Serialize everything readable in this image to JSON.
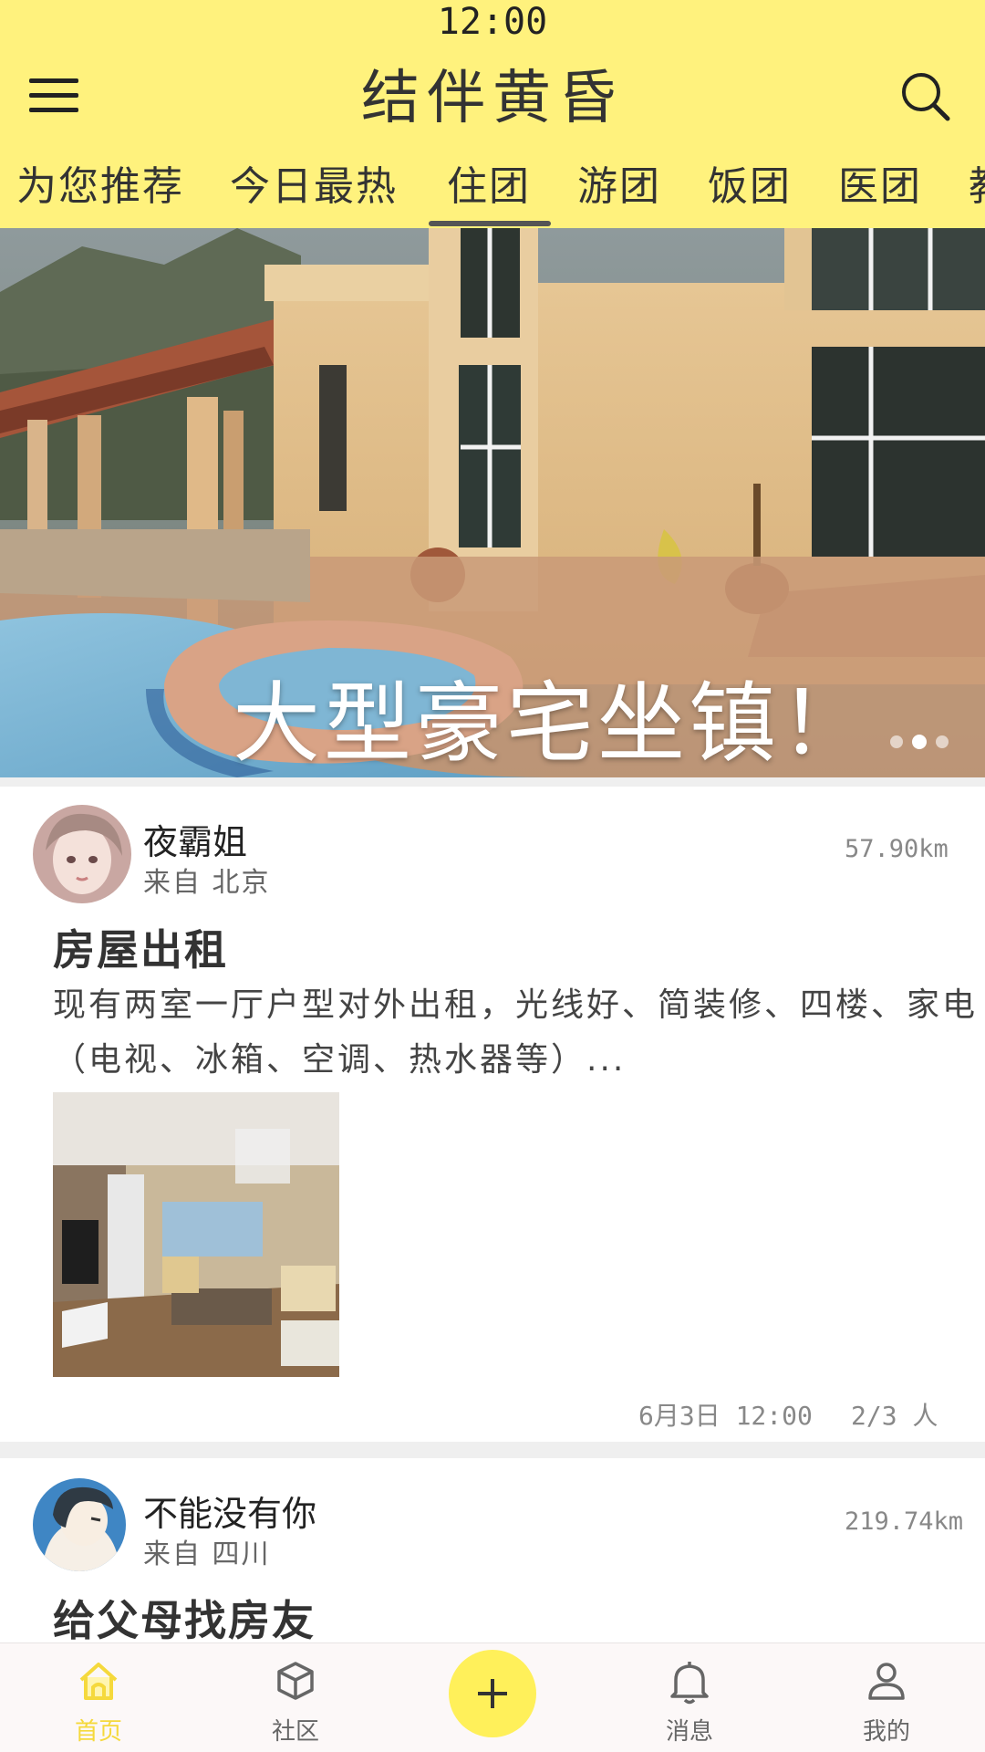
{
  "status_bar": {
    "time": "12:00"
  },
  "header": {
    "title": "结伴黄昏"
  },
  "tabs": [
    {
      "label": "为您推荐"
    },
    {
      "label": "今日最热"
    },
    {
      "label": "住团",
      "active": true
    },
    {
      "label": "游团"
    },
    {
      "label": "饭团"
    },
    {
      "label": "医团"
    },
    {
      "label": "教"
    }
  ],
  "banner": {
    "caption": "大型豪宅坐镇！",
    "total_slides": 3,
    "active_slide": 2
  },
  "posts": [
    {
      "user": "夜霸姐",
      "location": "来自 北京",
      "distance": "57.90km",
      "title": "房屋出租",
      "body": "现有两室一厅户型对外出租，光线好、简装修、四楼、家电（电视、冰箱、空调、热水器等）...",
      "date": "6月3日 12:00",
      "participants": "2/3 人"
    },
    {
      "user": "不能没有你",
      "location": "来自 四川",
      "distance": "219.74km",
      "title": "给父母找房友"
    }
  ],
  "bottom_nav": {
    "home": "首页",
    "community": "社区",
    "add_icon": "plus-icon",
    "messages": "消息",
    "profile": "我的"
  },
  "colors": {
    "header_bg": "#FFF27D",
    "accent": "#F5D93C",
    "add_button": "#FFF05A"
  }
}
